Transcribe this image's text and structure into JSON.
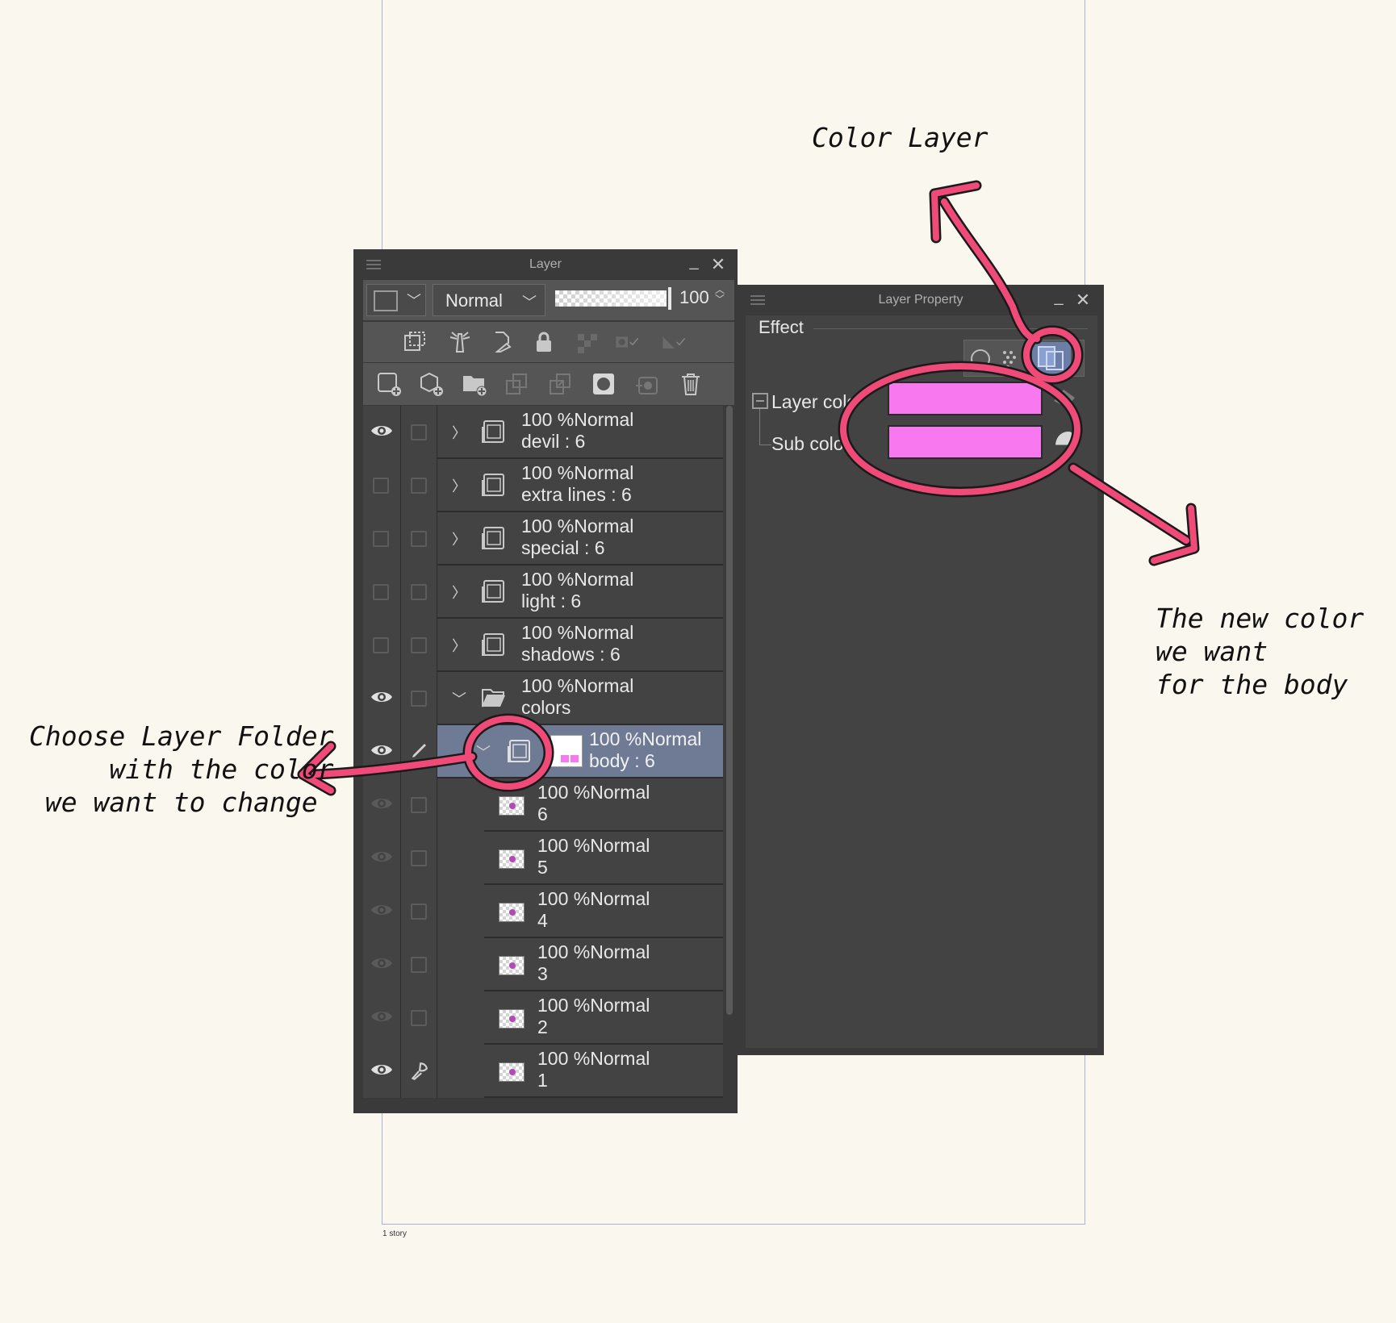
{
  "layer_panel": {
    "title": "Layer",
    "minimize": "_",
    "close": "✕",
    "blend_mode": "Normal",
    "opacity_value": "100",
    "layers": [
      {
        "opacity": "100 %",
        "mode": "Normal",
        "name": "devil : 6",
        "visible": true
      },
      {
        "opacity": "100 %",
        "mode": "Normal",
        "name": "extra lines : 6",
        "visible": false
      },
      {
        "opacity": "100 %",
        "mode": "Normal",
        "name": "special : 6",
        "visible": false
      },
      {
        "opacity": "100 %",
        "mode": "Normal",
        "name": "light : 6",
        "visible": false
      },
      {
        "opacity": "100 %",
        "mode": "Normal",
        "name": "shadows : 6",
        "visible": false
      },
      {
        "opacity": "100 %",
        "mode": "Normal",
        "name": "colors",
        "visible": true
      },
      {
        "opacity": "100 %",
        "mode": "Normal",
        "name": "body : 6",
        "visible": true,
        "selected": true
      },
      {
        "opacity": "100 %",
        "mode": "Normal",
        "name": "6"
      },
      {
        "opacity": "100 %",
        "mode": "Normal",
        "name": "5"
      },
      {
        "opacity": "100 %",
        "mode": "Normal",
        "name": "4"
      },
      {
        "opacity": "100 %",
        "mode": "Normal",
        "name": "3"
      },
      {
        "opacity": "100 %",
        "mode": "Normal",
        "name": "2"
      },
      {
        "opacity": "100 %",
        "mode": "Normal",
        "name": "1",
        "visible": true
      }
    ]
  },
  "property_panel": {
    "title": "Layer Property",
    "minimize": "_",
    "close": "✕",
    "effect_label": "Effect",
    "layer_color_label": "Layer colo",
    "sub_color_label": "Sub color",
    "layer_color": "#f878f0",
    "sub_color": "#f878f0"
  },
  "annotations": {
    "color_layer": "Color Layer",
    "new_color": "The new color\nwe want\nfor the body",
    "choose_folder": "Choose Layer Folder\n     with the color\n we want to change"
  },
  "page": {
    "story_label": "1 story"
  },
  "colors": {
    "annotation_pink": "#f04a78",
    "selected_row": "#6f7a95"
  }
}
